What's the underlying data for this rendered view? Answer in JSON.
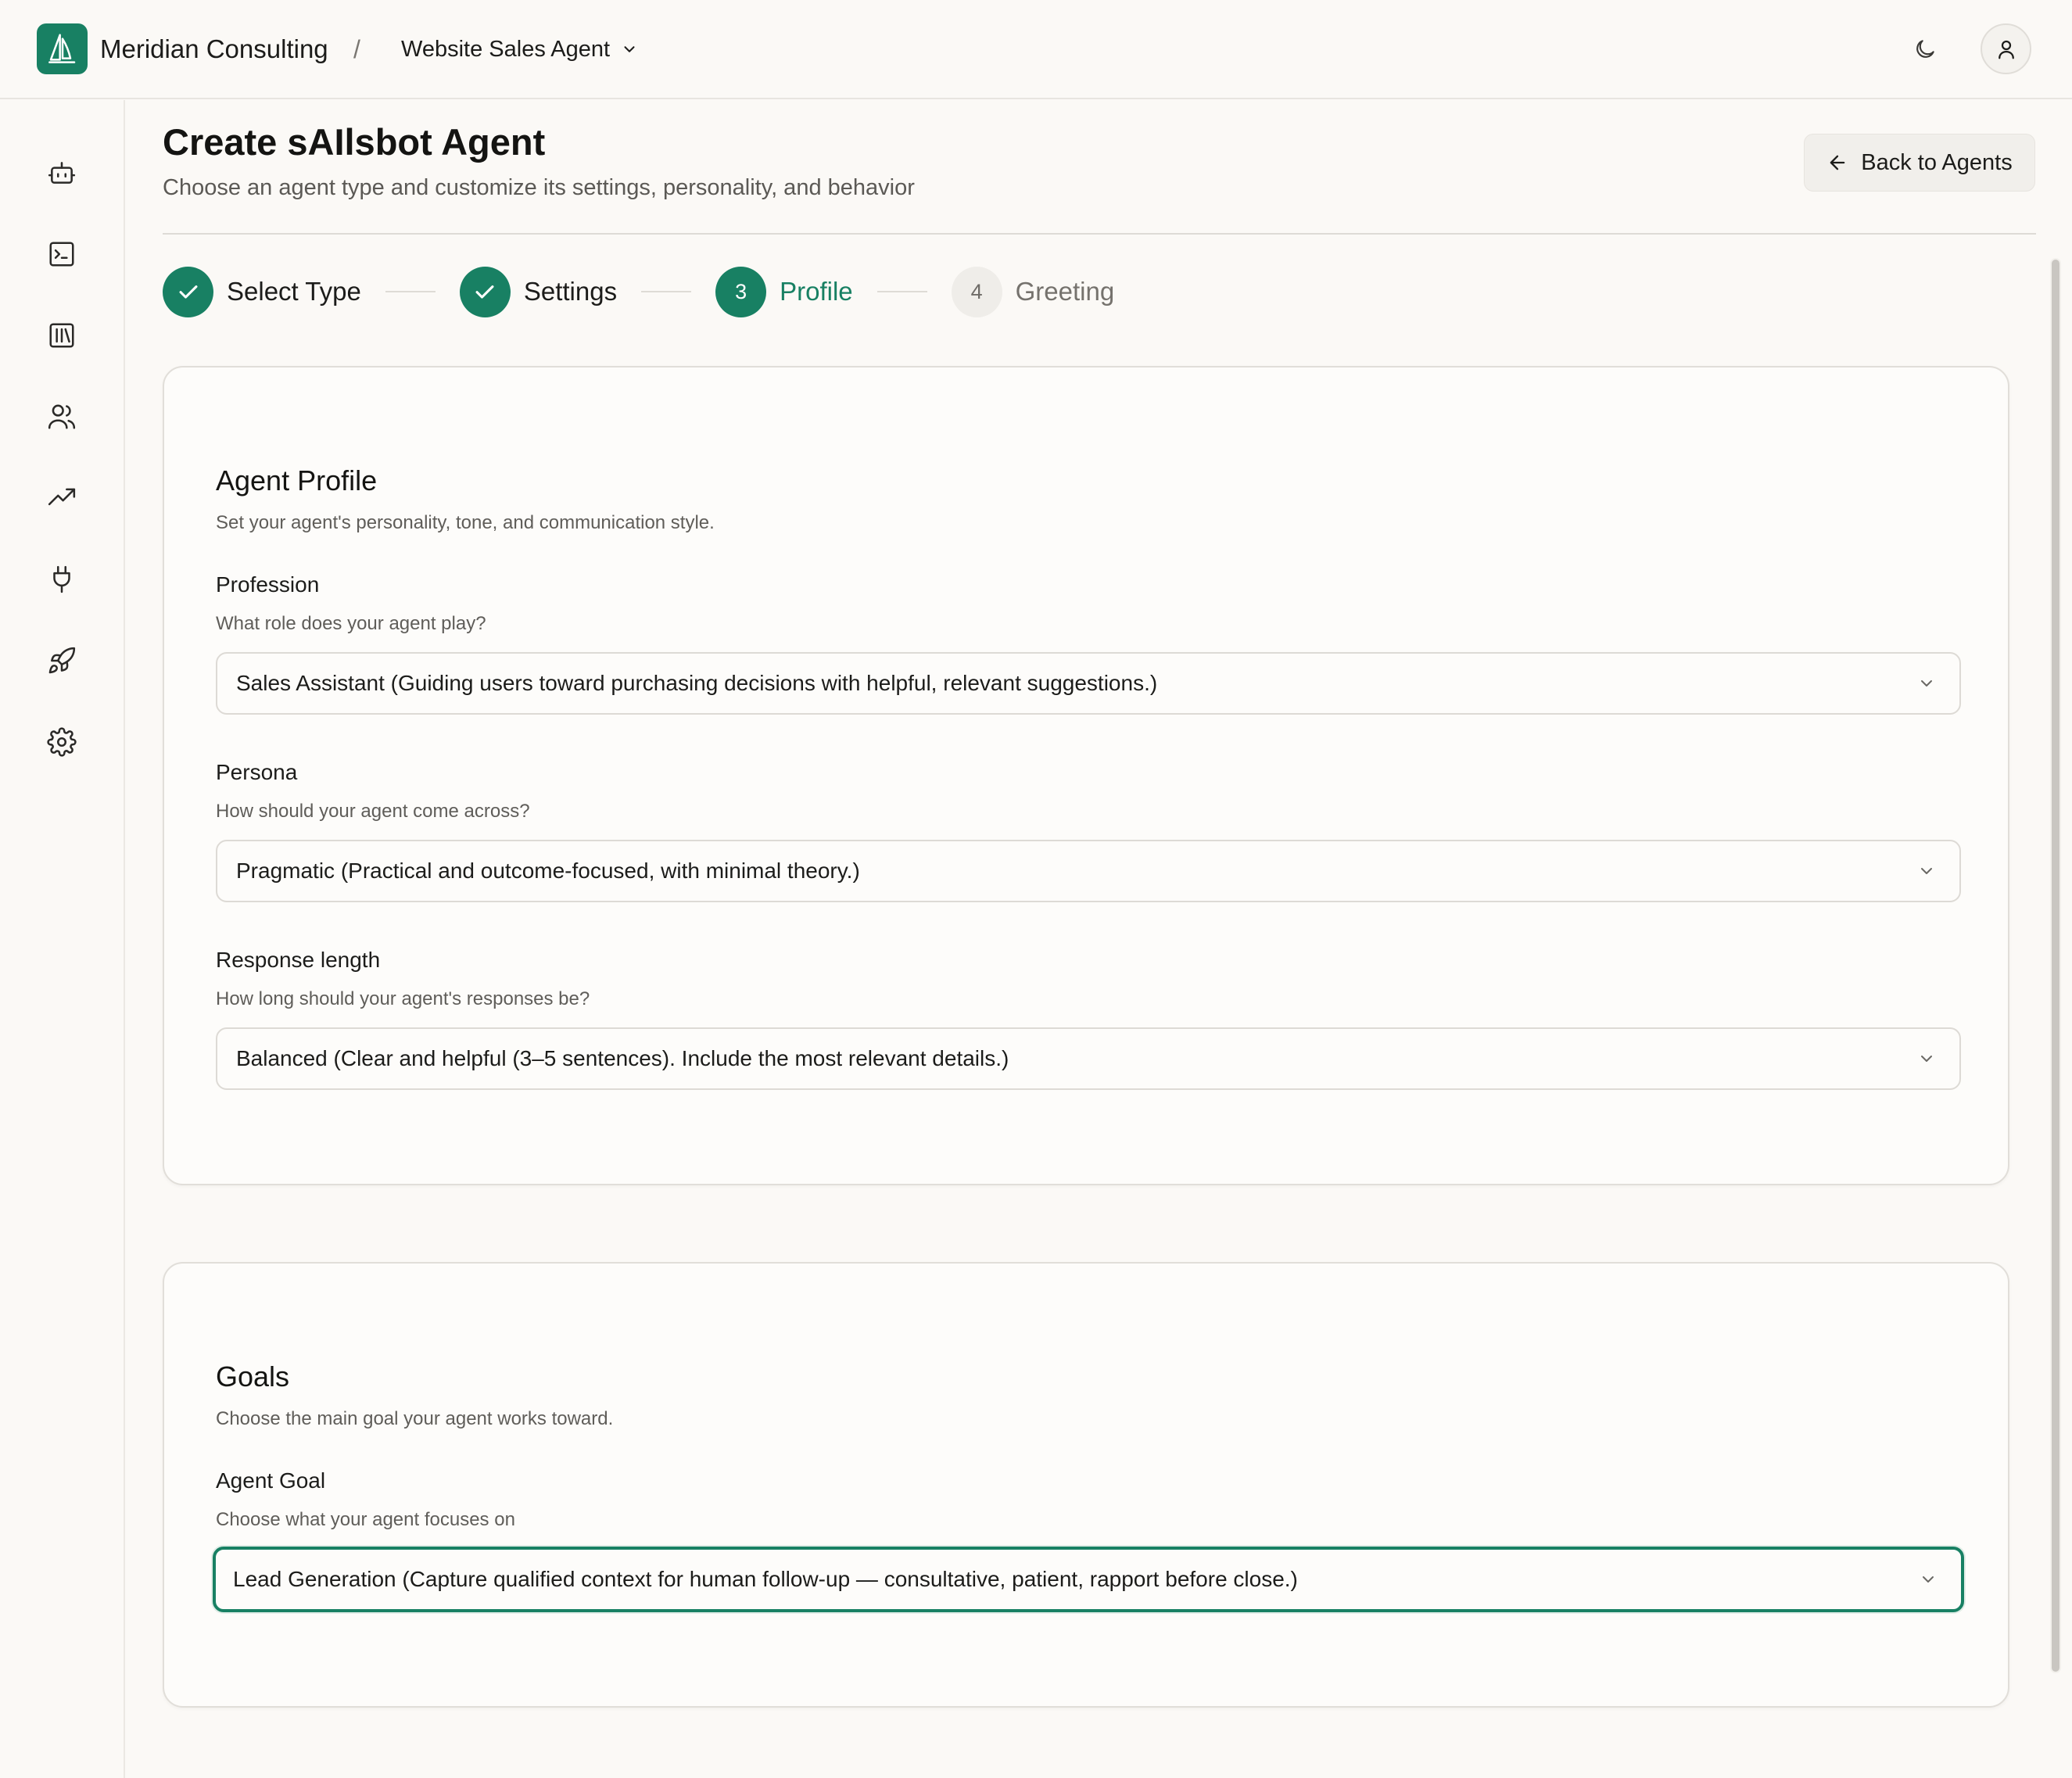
{
  "header": {
    "brand": "Meridian Consulting",
    "separator": "/",
    "agent_selector": "Website Sales Agent"
  },
  "sidebar": {
    "items": [
      {
        "name": "bot-icon"
      },
      {
        "name": "terminal-icon"
      },
      {
        "name": "library-icon"
      },
      {
        "name": "users-icon"
      },
      {
        "name": "trending-up-icon"
      },
      {
        "name": "plug-icon"
      },
      {
        "name": "rocket-icon"
      },
      {
        "name": "settings-icon"
      }
    ]
  },
  "page": {
    "title": "Create sAIlsbot Agent",
    "subtitle": "Choose an agent type and customize its settings, personality, and behavior",
    "back_label": "Back to Agents"
  },
  "steps": [
    {
      "number": "1",
      "label": "Select Type",
      "state": "done"
    },
    {
      "number": "2",
      "label": "Settings",
      "state": "done"
    },
    {
      "number": "3",
      "label": "Profile",
      "state": "active"
    },
    {
      "number": "4",
      "label": "Greeting",
      "state": "pending"
    }
  ],
  "profile_card": {
    "title": "Agent Profile",
    "description": "Set your agent's personality, tone, and communication style.",
    "profession": {
      "label": "Profession",
      "hint": "What role does your agent play?",
      "value": "Sales Assistant (Guiding users toward purchasing decisions with helpful, relevant suggestions.)"
    },
    "persona": {
      "label": "Persona",
      "hint": "How should your agent come across?",
      "value": "Pragmatic (Practical and outcome-focused, with minimal theory.)"
    },
    "response_length": {
      "label": "Response length",
      "hint": "How long should your agent's responses be?",
      "value": "Balanced (Clear and helpful (3–5 sentences). Include the most relevant details.)"
    }
  },
  "goals_card": {
    "title": "Goals",
    "description": "Choose the main goal your agent works toward.",
    "agent_goal": {
      "label": "Agent Goal",
      "hint": "Choose what your agent focuses on",
      "value": "Lead Generation (Capture qualified context for human follow-up — consultative, patient, rapport before close.)"
    }
  },
  "colors": {
    "accent": "#188063",
    "background": "#fbf9f6",
    "border": "#e1ded9"
  }
}
